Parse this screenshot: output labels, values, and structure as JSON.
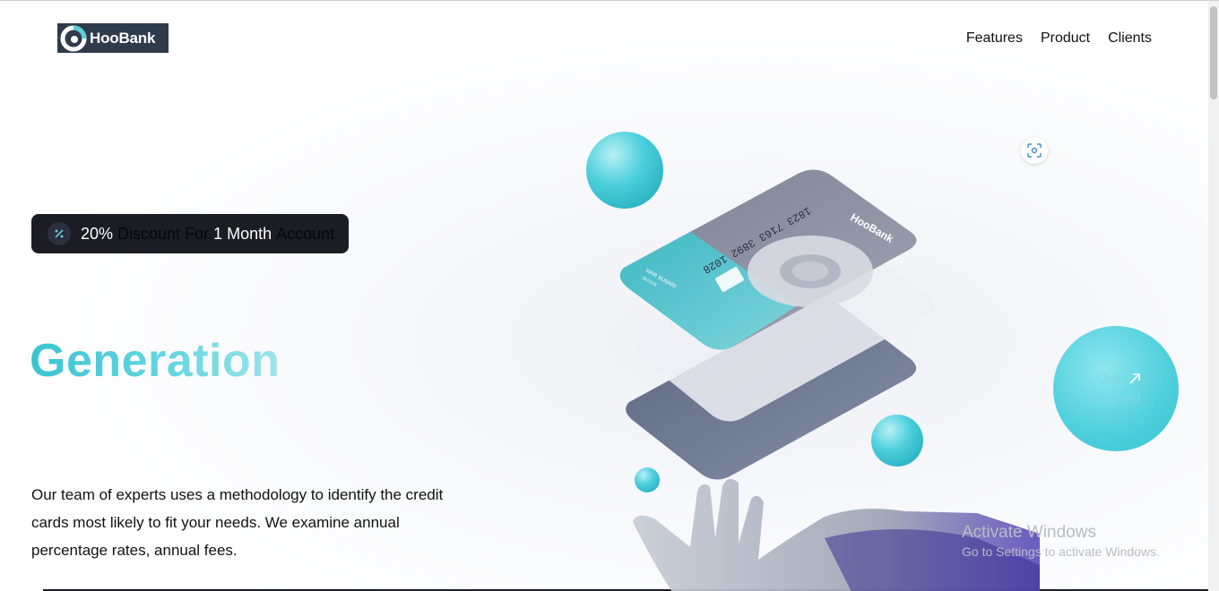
{
  "brand": {
    "name": "HooBank"
  },
  "nav": {
    "items": [
      "Features",
      "Product",
      "Clients"
    ]
  },
  "hero": {
    "discount": {
      "percent": "20%",
      "text1": "Discount For",
      "duration": "1 Month",
      "text2": "Account"
    },
    "heading": "Generation",
    "description": "Our team of experts uses a methodology to identify the credit cards most likely to fit your needs. We examine annual percentage rates, annual fees."
  },
  "card": {
    "number": "1823 7163 3892 1028",
    "holder": "WAR SUNARI",
    "expiry": "06/2026",
    "brand": "HooBank"
  },
  "cta": {
    "line1": "Get",
    "line2": "Started"
  },
  "os_watermark": {
    "title": "Activate Windows",
    "subtitle": "Go to Settings to activate Windows."
  },
  "colors": {
    "accent": "#39c4cf",
    "dark": "#1b1c24",
    "logo_bg": "#2f3b4d"
  },
  "icons": {
    "discount": "percent-icon",
    "scan": "scan-icon",
    "arrow": "arrow-up-right-icon"
  }
}
